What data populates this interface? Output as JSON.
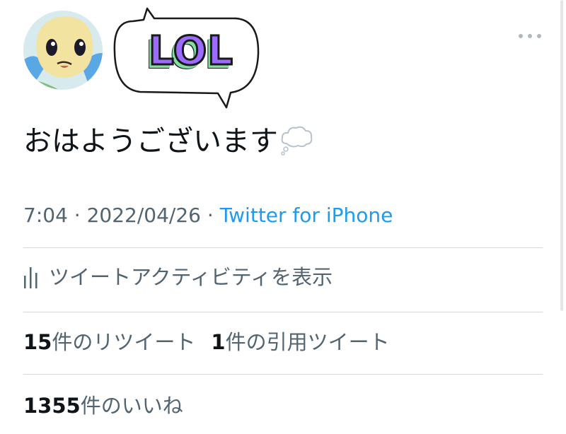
{
  "bubble_name": "LOL",
  "tweet": {
    "text": "おはようございます",
    "emoji": "thought-balloon-icon"
  },
  "meta": {
    "time": "7:04",
    "separator": " · ",
    "date": "2022/04/26",
    "source": "Twitter for iPhone"
  },
  "activity": {
    "label": "ツイートアクティビティを表示",
    "icon": "analytics-bars-icon"
  },
  "stats": {
    "retweets_count": "15",
    "retweets_label": "件のリツイート",
    "quotes_count": "1",
    "quotes_label": "件の引用ツイート",
    "likes_count": "1355",
    "likes_label": "件のいいね"
  },
  "colors": {
    "link": "#1d9bf0",
    "secondary_text": "#536471",
    "primary_text": "#0f1419",
    "bubble_text": "#9b6cff",
    "bubble_shadow": "#7fe0a0"
  }
}
